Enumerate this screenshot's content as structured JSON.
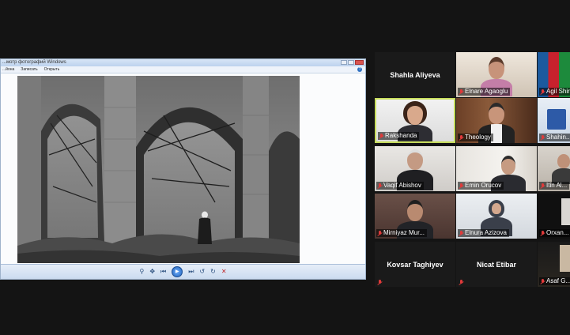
{
  "viewer": {
    "title": "...мотр фотографий Windows",
    "menu": [
      "...йона",
      "Записать",
      "Открыть"
    ],
    "help": "?"
  },
  "participants": [
    {
      "name": "Shahla Aliyeva",
      "muted": false,
      "video": false
    },
    {
      "name": "Elnare Agaoglu",
      "muted": true,
      "video": true
    },
    {
      "name": "Agil Shirin...",
      "muted": true,
      "video": true
    },
    {
      "name": "Rakshanda",
      "muted": true,
      "video": true,
      "active": true
    },
    {
      "name": "Theology",
      "muted": true,
      "video": true
    },
    {
      "name": "Shahin...",
      "muted": true,
      "video": true
    },
    {
      "name": "Vaqif Abishov",
      "muted": true,
      "video": true
    },
    {
      "name": "Emin Orucov",
      "muted": true,
      "video": true
    },
    {
      "name": "Itin Al...",
      "muted": true,
      "video": true
    },
    {
      "name": "Mirniyaz Mur...",
      "muted": true,
      "video": true
    },
    {
      "name": "Elnura Azizova",
      "muted": true,
      "video": true
    },
    {
      "name": "Orxan...",
      "muted": true,
      "video": true
    },
    {
      "name": "Kovsar Taghiyev",
      "muted": true,
      "video": false
    },
    {
      "name": "Nicat Etibar",
      "muted": true,
      "video": false
    },
    {
      "name": "Asaf G...",
      "muted": true,
      "video": true
    }
  ],
  "colors": {
    "active_border": "#c7dd5d",
    "mic_muted": "#e03a3a",
    "background": "#141414"
  }
}
